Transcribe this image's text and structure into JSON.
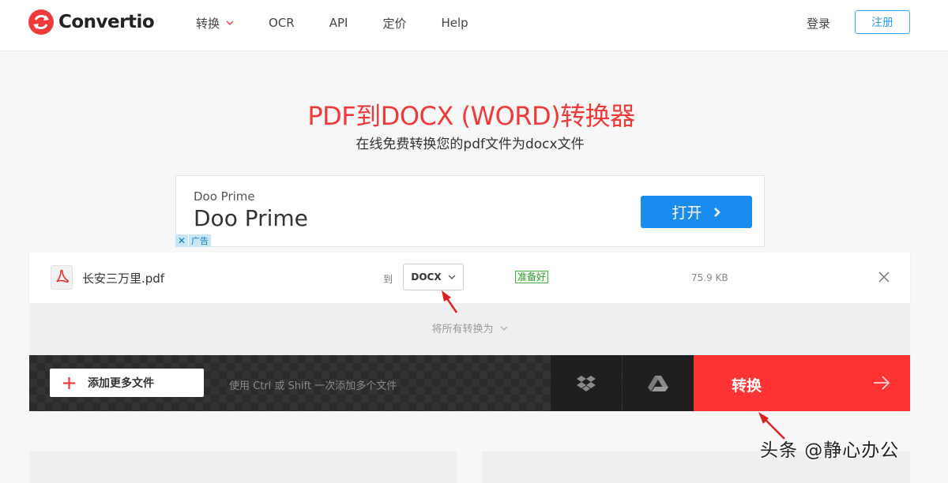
{
  "header": {
    "brand": "Convertio",
    "nav": [
      {
        "label": "转换"
      },
      {
        "label": "OCR"
      },
      {
        "label": "API"
      },
      {
        "label": "定价"
      },
      {
        "label": "Help"
      }
    ],
    "login_label": "登录",
    "signup_label": "注册"
  },
  "hero": {
    "title": "PDF到DOCX (WORD)转换器",
    "subtitle": "在线免费转换您的pdf文件为docx文件"
  },
  "ad": {
    "small_text": "Doo Prime",
    "big_text": "Doo Prime",
    "open_label": "打开",
    "close_label": "✕",
    "tag_label": "广告"
  },
  "file": {
    "name": "长安三万里.pdf",
    "to_label": "到",
    "format": "DOCX",
    "status": "准备好",
    "size": "75.9 KB"
  },
  "convert_all_label": "将所有转换为",
  "actions": {
    "add_files_label": "添加更多文件",
    "hint": "使用 Ctrl 或 Shift 一次添加多个文件",
    "convert_label": "转换"
  },
  "watermark": "头条 @静心办公",
  "colors": {
    "brand_red": "#ff3333",
    "title_red": "#f03a3a",
    "accent_blue": "#1a8cf0",
    "status_green": "#4ab24a"
  },
  "icons": {
    "logo": "convertio-logo-icon",
    "file": "pdf-file-icon",
    "dropbox": "dropbox-icon",
    "drive": "google-drive-icon"
  }
}
